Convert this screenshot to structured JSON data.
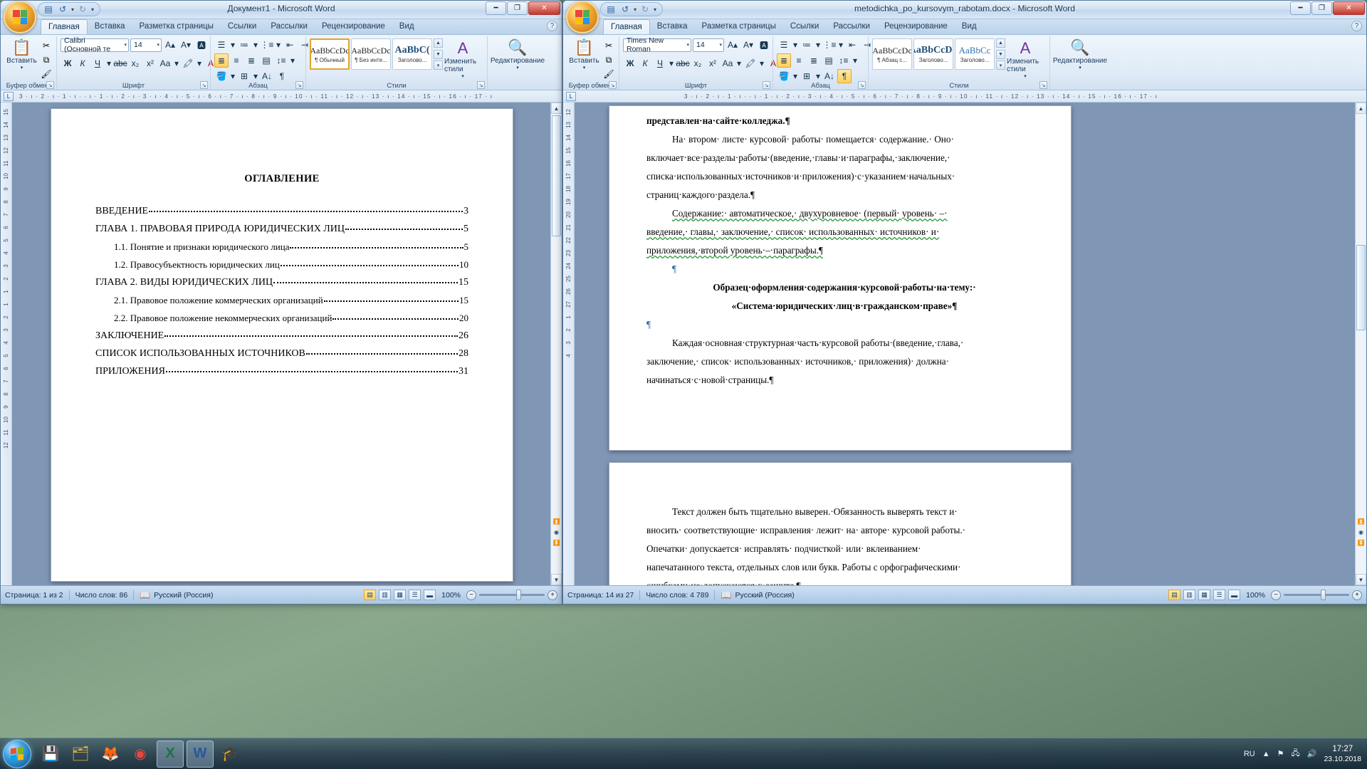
{
  "windows": {
    "left": {
      "title": "Документ1 - Microsoft Word",
      "tabs": [
        "Главная",
        "Вставка",
        "Разметка страницы",
        "Ссылки",
        "Рассылки",
        "Рецензирование",
        "Вид"
      ],
      "active_tab": "Главная",
      "ribbon": {
        "clipboard": {
          "label": "Буфер обмена",
          "paste": "Вставить"
        },
        "font": {
          "label": "Шрифт",
          "name": "Calibri (Основной те",
          "size": "14"
        },
        "paragraph": {
          "label": "Абзац"
        },
        "styles": {
          "label": "Стили",
          "items": [
            {
              "sample": "AaBbCcDc",
              "name": "¶ Обычный",
              "selected": true
            },
            {
              "sample": "AaBbCcDc",
              "name": "¶ Без инте...",
              "selected": false
            },
            {
              "sample": "AaBbC(",
              "name": "Заголово...",
              "selected": false
            }
          ],
          "change_styles": "Изменить стили"
        },
        "editing": {
          "label": "Редактирование"
        }
      },
      "ruler_ticks": "3 · ı · 2 · ı · 1 · ı ·  · ı · 1 · ı · 2 · ı · 3 · ı · 4 · ı · 5 · ı · 6 · ı · 7 · ı · 8 · ı · 9 · ı · 10 · ı · 11 · ı · 12 · ı · 13 · ı · 14 · ı · 15 · ı · 16 · ı · 17 · ı",
      "vruler_marks": [
        "15",
        "14",
        "13",
        "12",
        "11",
        "10",
        "9",
        "8",
        "7",
        "6",
        "5",
        "4",
        "3",
        "2",
        "1",
        "1",
        "2",
        "3",
        "4",
        "5",
        "6",
        "7",
        "8",
        "9",
        "10",
        "11",
        "12"
      ],
      "status": {
        "page": "Страница: 1 из 2",
        "words": "Число слов: 86",
        "language": "Русский (Россия)",
        "zoom": "100%"
      },
      "document": {
        "heading": "ОГЛАВЛЕНИЕ",
        "entries": [
          {
            "text": "ВВЕДЕНИЕ",
            "page": "3",
            "indent": false
          },
          {
            "text": "ГЛАВА 1. ПРАВОВАЯ ПРИРОДА ЮРИДИЧЕСКИХ ЛИЦ",
            "page": "5",
            "indent": false
          },
          {
            "text": "1.1. Понятие и признаки юридического лица",
            "page": "5",
            "indent": true
          },
          {
            "text": "1.2. Правосубъектность юридических лиц",
            "page": "10",
            "indent": true
          },
          {
            "text": "ГЛАВА 2. ВИДЫ ЮРИДИЧЕСКИХ ЛИЦ",
            "page": "15",
            "indent": false
          },
          {
            "text": "2.1. Правовое положение коммерческих организаций",
            "page": "15",
            "indent": true
          },
          {
            "text": "2.2. Правовое положение некоммерческих организаций",
            "page": "20",
            "indent": true
          },
          {
            "text": "ЗАКЛЮЧЕНИЕ",
            "page": "26",
            "indent": false
          },
          {
            "text": "СПИСОК ИСПОЛЬЗОВАННЫХ ИСТОЧНИКОВ",
            "page": "28",
            "indent": false
          },
          {
            "text": "ПРИЛОЖЕНИЯ",
            "page": "31",
            "indent": false
          }
        ]
      }
    },
    "right": {
      "title": "metodichka_po_kursovym_rabotam.docx - Microsoft Word",
      "tabs": [
        "Главная",
        "Вставка",
        "Разметка страницы",
        "Ссылки",
        "Рассылки",
        "Рецензирование",
        "Вид"
      ],
      "active_tab": "Главная",
      "ribbon": {
        "clipboard": {
          "label": "Буфер обмена",
          "paste": "Вставить"
        },
        "font": {
          "label": "Шрифт",
          "name": "Times New Roman",
          "size": "14"
        },
        "paragraph": {
          "label": "Абзац"
        },
        "styles": {
          "label": "Стили",
          "items": [
            {
              "sample": "AaBbCcDc",
              "name": "¶ Абзац с...",
              "selected": false
            },
            {
              "sample": "AaBbCcDd",
              "name": "Заголово...",
              "selected": false
            },
            {
              "sample": "AaBbCc",
              "name": "Заголово...",
              "selected": false
            }
          ],
          "change_styles": "Изменить стили"
        },
        "editing": {
          "label": "Редактирование"
        }
      },
      "ruler_ticks": "3 · ı · 2 · ı · 1 · ı ·  · ı · 1 · ı · 2 · ı · 3 · ı · 4 · ı · 5 · ı · 6 · ı · 7 · ı · 8 · ı · 9 · ı · 10 · ı · 11 · ı · 12 · ı · 13 · ı · 14 · ı · 15 · ı · 16 · ı · 17 · ı",
      "vruler_marks": [
        "12",
        "13",
        "14",
        "15",
        "16",
        "17",
        "18",
        "19",
        "20",
        "21",
        "22",
        "23",
        "24",
        "25",
        "26",
        "27",
        "1",
        "2",
        "3",
        "4"
      ],
      "status": {
        "page": "Страница: 14 из 27",
        "words": "Число слов: 4 789",
        "language": "Русский (Россия)",
        "zoom": "100%"
      },
      "document": {
        "page1": [
          {
            "type": "bold",
            "text": "представлен·на·сайте·колледжа.¶"
          },
          {
            "type": "indent",
            "text": "На· втором· листе· курсовой· работы· помещается· содержание.· Оно·"
          },
          {
            "type": "plain",
            "text": "включает·все·разделы·работы·(введение,·главы·и·параграфы,·заключение,·"
          },
          {
            "type": "plain",
            "text": "списка·использованных·источников·и·приложения)·с·указанием·начальных·"
          },
          {
            "type": "plain",
            "text": "страниц·каждого·раздела.¶"
          },
          {
            "type": "wavy-indent",
            "text": "Содержание:· автоматическое,· двухуровневое· (первый· уровень· –·"
          },
          {
            "type": "wavy",
            "text": "введение,· главы,· заключение,· список· использованных· источников· и·"
          },
          {
            "type": "wavy",
            "text": "приложения,·второй уровень·–·параграфы.¶"
          },
          {
            "type": "pilcrow",
            "text": "¶"
          },
          {
            "type": "center-bold",
            "text": "Образец·оформления·содержания·курсовой·работы·на·тему:·"
          },
          {
            "type": "center-bold",
            "text": "«Система·юридических·лиц·в·гражданском·праве»¶"
          },
          {
            "type": "pilcrow-left",
            "text": "¶"
          },
          {
            "type": "indent",
            "text": "Каждая·основная·структурная·часть·курсовой работы·(введение,·глава,·"
          },
          {
            "type": "plain",
            "text": "заключение,· список· использованных· источников,· приложения)· должна·"
          },
          {
            "type": "plain",
            "text": "начинаться·с·новой·страницы.¶"
          }
        ],
        "page2": [
          {
            "type": "indent",
            "text": "Текст должен быть тщательно выверен.·Обязанность выверять текст и·"
          },
          {
            "type": "plain",
            "text": "вносить· соответствующие· исправления· лежит· на· авторе· курсовой работы.·"
          },
          {
            "type": "plain",
            "text": "Опечатки· допускается· исправлять· подчисткой· или· вклеиванием·"
          },
          {
            "type": "plain",
            "text": "напечатанного текста, отдельных слов или букв. Работы с орфографическими·"
          },
          {
            "type": "plain",
            "text": "ошибками·не·допускаются·к·защите.¶"
          }
        ]
      }
    }
  },
  "taskbar": {
    "items": [
      {
        "name": "start",
        "glyph": ""
      },
      {
        "name": "save-floppy",
        "glyph": "💾"
      },
      {
        "name": "folder",
        "glyph": "🗂"
      },
      {
        "name": "firefox",
        "glyph": "🦊"
      },
      {
        "name": "chrome",
        "glyph": "◉"
      },
      {
        "name": "excel",
        "glyph": "X"
      },
      {
        "name": "word",
        "glyph": "W"
      },
      {
        "name": "graduate",
        "glyph": "🎓"
      }
    ],
    "tray": {
      "language": "RU",
      "time": "17:27",
      "date": "23.10.2018"
    }
  },
  "colors": {
    "accent": "#2a5d9e",
    "close_red": "#c0392b",
    "highlight_orange": "#e0a32e",
    "spell_green": "#2e9a3e"
  }
}
